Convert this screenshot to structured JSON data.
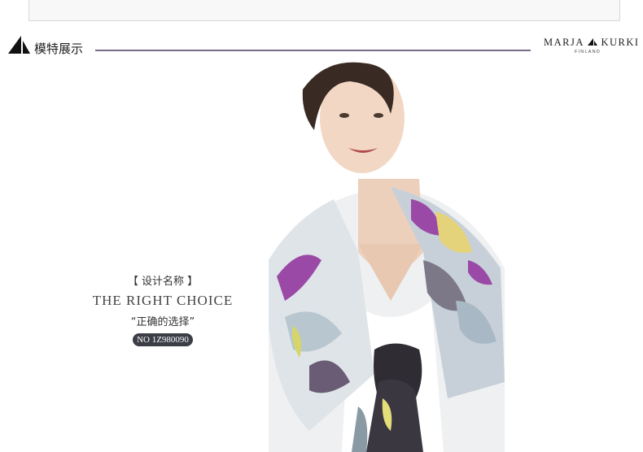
{
  "header": {
    "section_title": "模特展示",
    "icon": "sail-icon"
  },
  "brand": {
    "name": "MARJA KURKI",
    "name_left": "MARJA",
    "name_right": "KURKI",
    "subtitle": "FINLAND"
  },
  "design": {
    "label": "【 设计名称 】",
    "name": "THE RIGHT CHOICE",
    "subtitle": "“正确的选择”",
    "number": "NO 1Z980090"
  },
  "colors": {
    "divider": "#7a6a8c",
    "badge": "#3b3e45"
  }
}
